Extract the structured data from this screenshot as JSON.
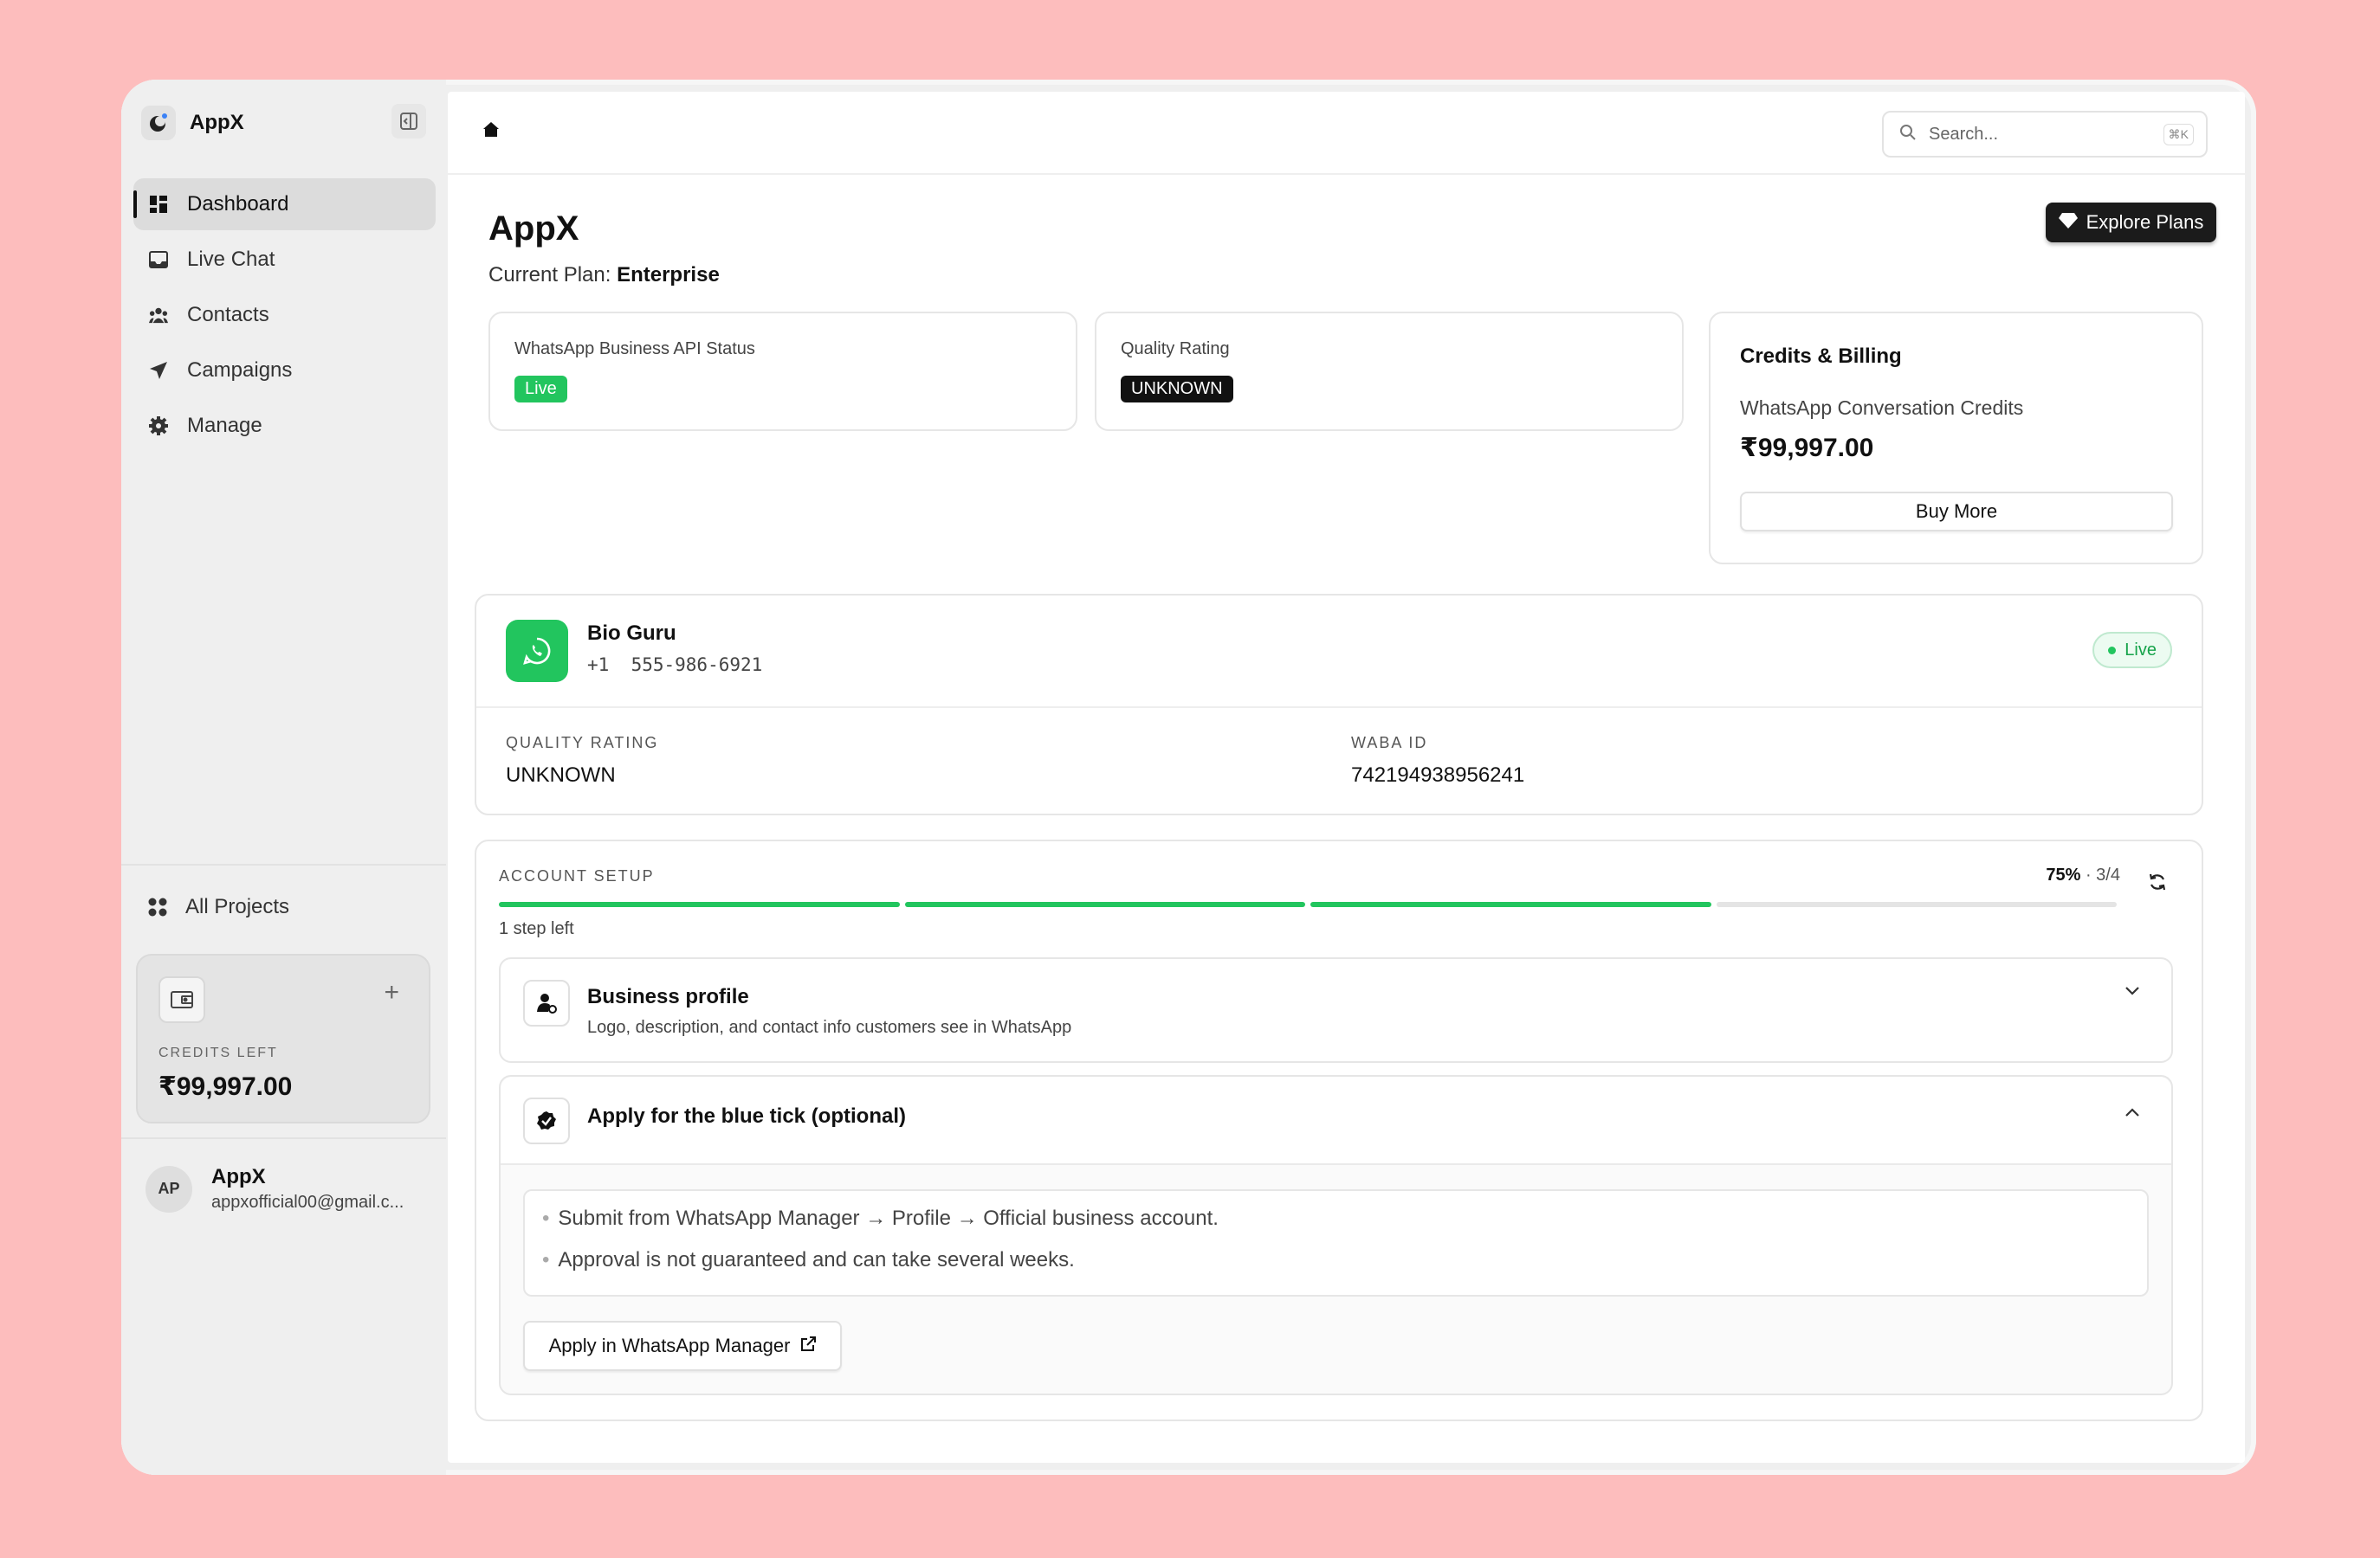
{
  "app": {
    "name": "AppX"
  },
  "sidebar": {
    "nav": [
      {
        "label": "Dashboard",
        "icon": "dashboard-icon",
        "active": true
      },
      {
        "label": "Live Chat",
        "icon": "inbox-icon"
      },
      {
        "label": "Contacts",
        "icon": "contacts-icon"
      },
      {
        "label": "Campaigns",
        "icon": "send-icon"
      },
      {
        "label": "Manage",
        "icon": "gear-icon"
      }
    ],
    "all_projects": "All Projects",
    "credits": {
      "label": "CREDITS LEFT",
      "value": "₹99,997.00"
    },
    "user": {
      "initials": "AP",
      "name": "AppX",
      "email": "appxofficial00@gmail.c..."
    }
  },
  "topbar": {
    "search_placeholder": "Search...",
    "shortcut": "⌘K"
  },
  "header": {
    "title": "AppX",
    "plan_label": "Current Plan:",
    "plan_value": "Enterprise",
    "explore_button": "Explore Plans"
  },
  "status_cards": {
    "api_status_label": "WhatsApp Business API Status",
    "api_status_value": "Live",
    "quality_label": "Quality Rating",
    "quality_value": "UNKNOWN"
  },
  "billing": {
    "title": "Credits & Billing",
    "subtitle": "WhatsApp Conversation Credits",
    "amount": "₹99,997.00",
    "buy_button": "Buy More"
  },
  "account": {
    "name": "Bio Guru",
    "phone": "+1  555-986-6921",
    "status": "Live",
    "quality_label": "QUALITY RATING",
    "quality_value": "UNKNOWN",
    "waba_label": "WABA ID",
    "waba_value": "742194938956241"
  },
  "setup": {
    "title": "ACCOUNT SETUP",
    "percent": "75%",
    "fraction": "· 3/4",
    "progress_fraction": 0.75,
    "steps_left": "1 step left",
    "steps": [
      {
        "title": "Business profile",
        "description": "Logo, description, and contact info customers see in WhatsApp",
        "expanded": false
      },
      {
        "title": "Apply for the blue tick (optional)",
        "expanded": true,
        "bullets": [
          "Submit from WhatsApp Manager → Profile → Official business account.",
          "Approval is not guaranteed and can take several weeks."
        ],
        "action": "Apply in WhatsApp Manager"
      }
    ]
  },
  "colors": {
    "accent_green": "#22c55e",
    "dark": "#1b1b1b",
    "background": "#fdbdbd"
  }
}
